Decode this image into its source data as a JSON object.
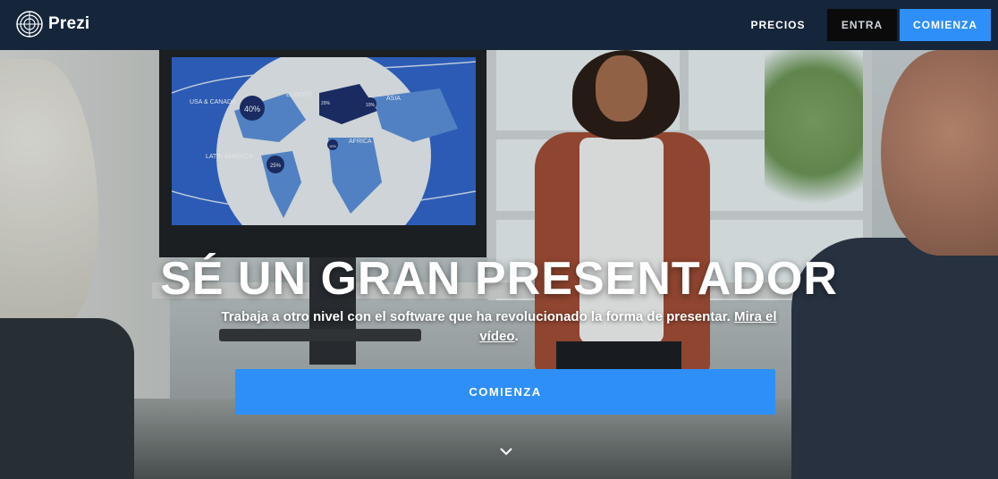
{
  "brand": {
    "name": "Prezi",
    "logo_icon": "prezi-logo-icon"
  },
  "nav": {
    "precios": "PRECIOS",
    "entra": "ENTRA",
    "comienza": "COMIENZA"
  },
  "hero": {
    "headline": "SÉ UN GRAN PRESENTADOR",
    "subtitle_text": "Trabaja a otro nivel con el software que ha revolucionado la forma de presentar.",
    "subtitle_link": "Mira el vídeo",
    "subtitle_end": ".",
    "cta_label": "COMIENZA",
    "scroll_icon": "chevron-down-icon"
  },
  "map": {
    "labels": [
      "USA & CANADA",
      "EUROPE",
      "ASIA",
      "AFRICA",
      "LATIN AMERICA"
    ],
    "values": [
      "40%",
      "20%",
      "10%",
      "10%",
      "25%"
    ]
  },
  "colors": {
    "nav_bg": "#15253a",
    "accent": "#2e8ff9",
    "entra_bg": "#0b0b0b"
  }
}
